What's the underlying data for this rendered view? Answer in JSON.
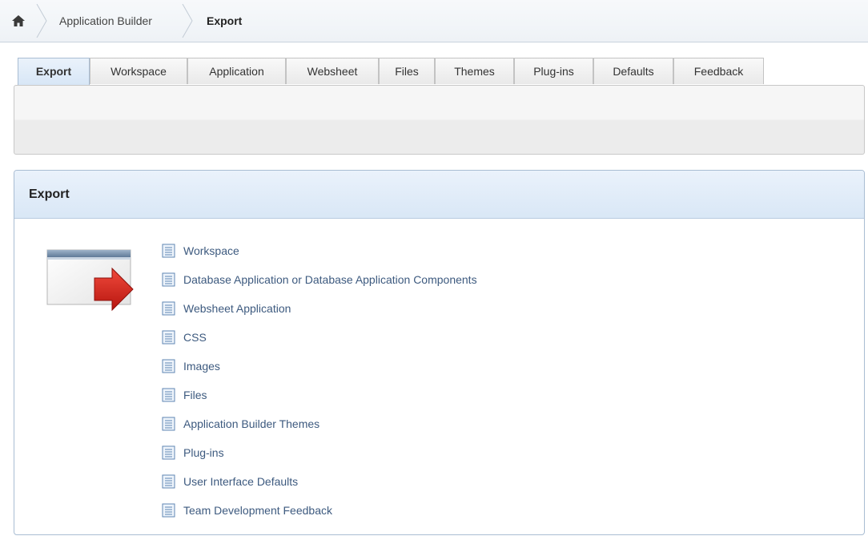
{
  "breadcrumb": {
    "home_icon": "home-icon",
    "items": [
      "Application Builder",
      "Export"
    ]
  },
  "tabs": [
    {
      "label": "Export",
      "active": true
    },
    {
      "label": "Workspace"
    },
    {
      "label": "Application"
    },
    {
      "label": "Websheet"
    },
    {
      "label": "Files"
    },
    {
      "label": "Themes"
    },
    {
      "label": "Plug-ins"
    },
    {
      "label": "Defaults"
    },
    {
      "label": "Feedback"
    }
  ],
  "region": {
    "title": "Export",
    "illustration": "export-window-arrow-icon",
    "links": [
      "Workspace",
      "Database Application or Database Application Components",
      "Websheet Application",
      "CSS",
      "Images",
      "Files",
      "Application Builder Themes",
      "Plug-ins",
      "User Interface Defaults",
      "Team Development Feedback"
    ]
  },
  "colors": {
    "link": "#3d5a7f",
    "accent_red": "#d8241f",
    "header_blue": "#dbe8f6"
  }
}
